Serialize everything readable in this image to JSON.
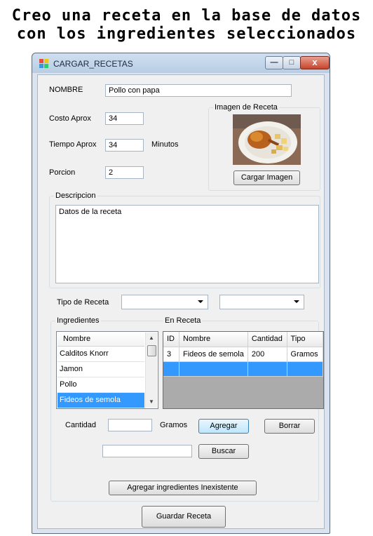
{
  "heading": {
    "line1": "Creo una receta en la base de datos",
    "line2": "con los ingredientes seleccionados"
  },
  "window": {
    "title": "CARGAR_RECETAS",
    "controls": {
      "minimize": "—",
      "maximize": "□",
      "close": "x"
    }
  },
  "form": {
    "nombre_label": "NOMBRE",
    "nombre_value": "Pollo con papa",
    "costo_label": "Costo Aprox",
    "costo_value": "34",
    "tiempo_label": "Tiempo Aprox",
    "tiempo_value": "34",
    "tiempo_unit": "Minutos",
    "porcion_label": "Porcion",
    "porcion_value": "2",
    "imagen_group": "Imagen de Receta",
    "cargar_imagen_button": "Cargar Imagen",
    "descripcion_group": "Descripcion",
    "descripcion_value": "Datos de la receta",
    "tipo_label": "Tipo de Receta",
    "tipo_combo1_value": "",
    "tipo_combo2_value": ""
  },
  "ingredientes": {
    "group": "Ingredientes",
    "column_header": "Nombre",
    "items": [
      "Calditos Knorr",
      "Jamon",
      "Pollo",
      "Fideos de semola"
    ],
    "selected_index": 3
  },
  "en_receta": {
    "group": "En Receta",
    "columns": [
      "ID",
      "Nombre",
      "Cantidad",
      "Tipo"
    ],
    "rows": [
      [
        "3",
        "Fideos de semola",
        "200",
        "Gramos"
      ]
    ]
  },
  "cantidad": {
    "label": "Cantidad",
    "value": "",
    "unit": "Gramos",
    "agregar_button": "Agregar",
    "borrar_button": "Borrar"
  },
  "buscar": {
    "value": "",
    "button": "Buscar"
  },
  "agregar_inexistente_button": "Agregar ingredientes Inexistente",
  "guardar_button": "Guardar Receta"
}
